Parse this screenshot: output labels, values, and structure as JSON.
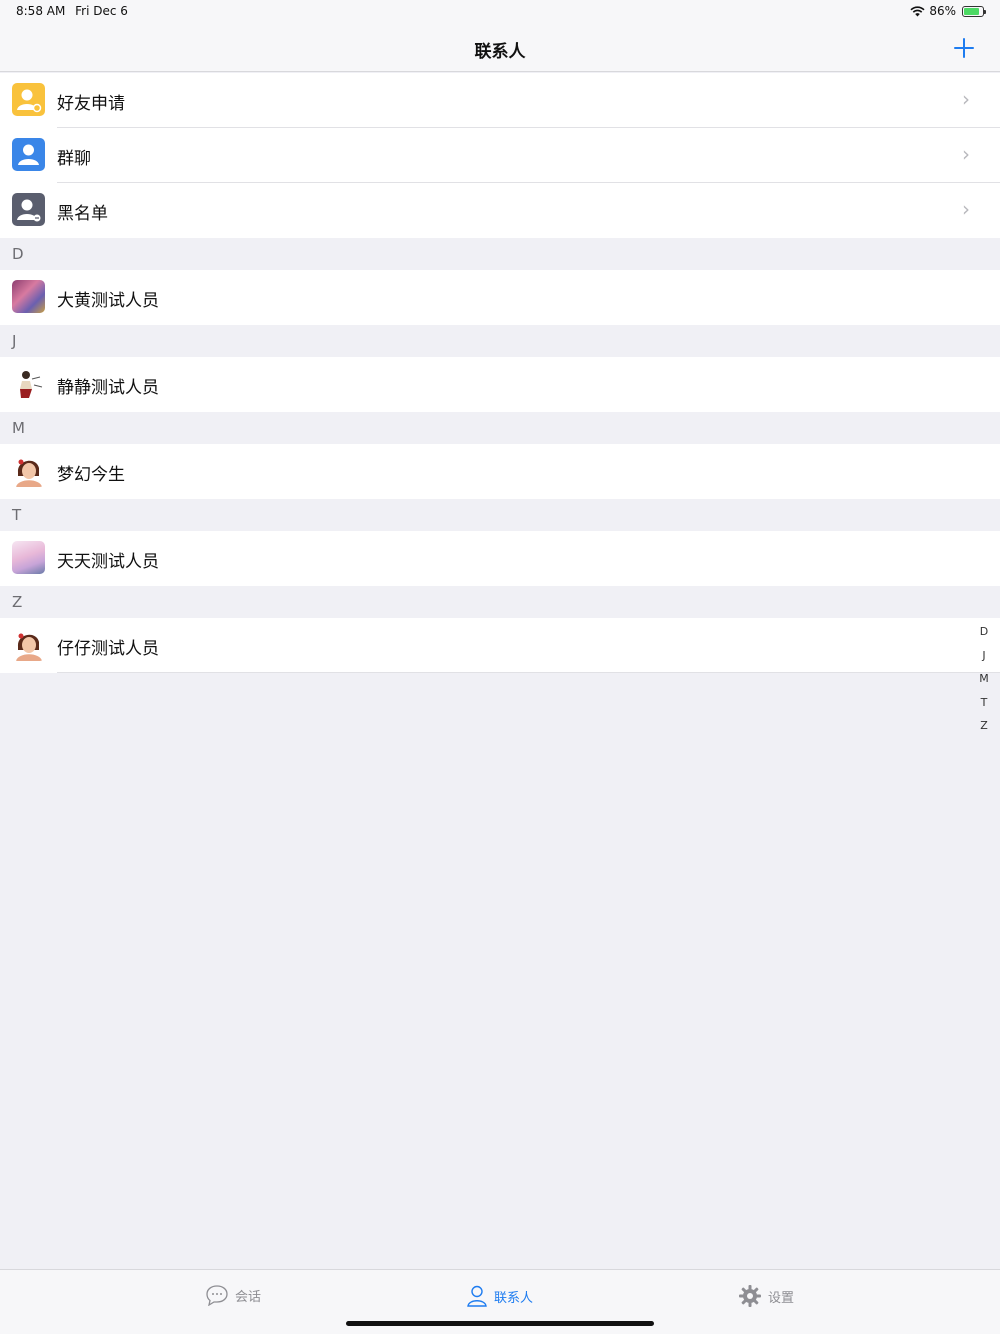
{
  "status": {
    "time": "8:58 AM",
    "date": "Fri Dec 6",
    "battery": "86%",
    "battery_level": 0.86
  },
  "nav": {
    "title": "联系人",
    "add_icon": "plus-icon"
  },
  "menu": [
    {
      "label": "好友申请",
      "icon": "friend-request-icon",
      "color": "#f9c23c"
    },
    {
      "label": "群聊",
      "icon": "group-chat-icon",
      "color": "#3a86e8"
    },
    {
      "label": "黑名单",
      "icon": "blacklist-icon",
      "color": "#5a5e6e"
    }
  ],
  "sections": [
    {
      "letter": "D",
      "contacts": [
        {
          "name": "大黄测试人员"
        }
      ]
    },
    {
      "letter": "J",
      "contacts": [
        {
          "name": "静静测试人员"
        }
      ]
    },
    {
      "letter": "M",
      "contacts": [
        {
          "name": "梦幻今生"
        }
      ]
    },
    {
      "letter": "T",
      "contacts": [
        {
          "name": "天天测试人员"
        }
      ]
    },
    {
      "letter": "Z",
      "contacts": [
        {
          "name": "仔仔测试人员"
        }
      ]
    }
  ],
  "index": [
    "D",
    "J",
    "M",
    "T",
    "Z"
  ],
  "tabs": [
    {
      "label": "会话",
      "icon": "chat-icon"
    },
    {
      "label": "联系人",
      "icon": "contacts-icon",
      "active": true
    },
    {
      "label": "设置",
      "icon": "gear-icon"
    }
  ]
}
